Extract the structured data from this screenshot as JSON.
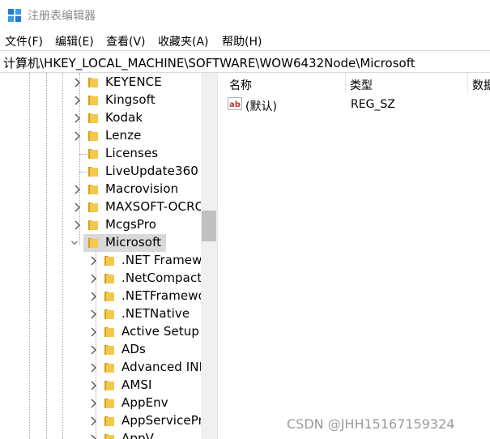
{
  "window": {
    "title": "注册表编辑器"
  },
  "menu": [
    {
      "label": "文件(F)"
    },
    {
      "label": "编辑(E)"
    },
    {
      "label": "查看(V)"
    },
    {
      "label": "收藏夹(A)"
    },
    {
      "label": "帮助(H)"
    }
  ],
  "address": {
    "path": "计算机\\HKEY_LOCAL_MACHINE\\SOFTWARE\\WOW6432Node\\Microsoft"
  },
  "tree": {
    "items": [
      {
        "label": "KEYENCE",
        "expandable": true
      },
      {
        "label": "Kingsoft",
        "expandable": true
      },
      {
        "label": "Kodak",
        "expandable": true
      },
      {
        "label": "Lenze",
        "expandable": true
      },
      {
        "label": "Licenses",
        "expandable": false
      },
      {
        "label": "LiveUpdate360",
        "expandable": false
      },
      {
        "label": "Macrovision",
        "expandable": true
      },
      {
        "label": "MAXSOFT-OCRO",
        "expandable": true
      },
      {
        "label": "McgsPro",
        "expandable": true
      },
      {
        "label": "Microsoft",
        "expandable": true,
        "expanded": true,
        "selected": true
      }
    ],
    "children": [
      {
        "label": ".NET Framewo",
        "expandable": true
      },
      {
        "label": ".NetCompact",
        "expandable": true
      },
      {
        "label": ".NETFramewo",
        "expandable": true
      },
      {
        "label": ".NETNative",
        "expandable": true
      },
      {
        "label": "Active Setup",
        "expandable": true
      },
      {
        "label": "ADs",
        "expandable": true
      },
      {
        "label": "Advanced INF",
        "expandable": true
      },
      {
        "label": "AMSI",
        "expandable": true
      },
      {
        "label": "AppEnv",
        "expandable": true
      },
      {
        "label": "AppServicePr",
        "expandable": true
      },
      {
        "label": "AppV",
        "expandable": true
      }
    ]
  },
  "list": {
    "columns": [
      {
        "label": "名称"
      },
      {
        "label": "类型"
      },
      {
        "label": "数据"
      }
    ],
    "rows": [
      {
        "name": "(默认)",
        "type": "REG_SZ",
        "data": ""
      }
    ]
  },
  "watermark": "CSDN @JHH15167159324",
  "colors": {
    "folder": "#e8b730",
    "folder_dark": "#d99e14",
    "selection": "#d9d9d9",
    "ab_icon": "#c0392b"
  }
}
